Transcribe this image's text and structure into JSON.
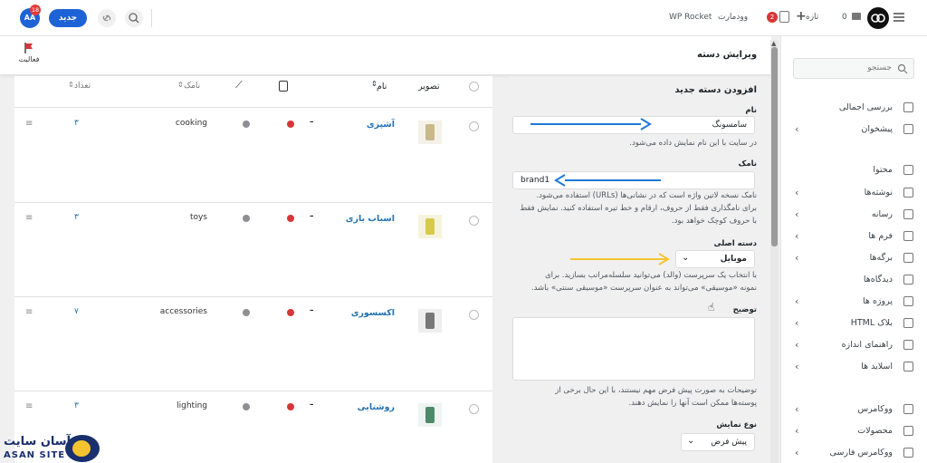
{
  "topbar": {
    "new_label": "جدید",
    "avatar_initials": "AA",
    "avatar_badge": "18",
    "wp_rocket": "WP Rocket",
    "wordmart": "وودمارت",
    "updates_count": "2",
    "new_item": "تازه",
    "comments_count": "0"
  },
  "sidebar": {
    "search_placeholder": "جستجو",
    "items": [
      {
        "label": "بررسی اجمالی",
        "icon": "dashboard-icon",
        "chevron": false
      },
      {
        "label": "پیشخوان",
        "icon": "grid-icon",
        "chevron": true
      },
      {
        "label": "محتوا",
        "icon": "database-icon",
        "chevron": false
      },
      {
        "label": "نوشته‌ها",
        "icon": "post-icon",
        "chevron": true
      },
      {
        "label": "رسانه",
        "icon": "media-icon",
        "chevron": true
      },
      {
        "label": "فرم ها",
        "icon": "form-icon",
        "chevron": true
      },
      {
        "label": "برگه‌ها",
        "icon": "page-icon",
        "chevron": true
      },
      {
        "label": "دیدگاه‌ها",
        "icon": "comment-icon",
        "chevron": false
      },
      {
        "label": "پروژه ها",
        "icon": "portfolio-icon",
        "chevron": true
      },
      {
        "label": "بلاک HTML",
        "icon": "html-block-icon",
        "chevron": true
      },
      {
        "label": "راهنمای اندازه",
        "icon": "size-guide-icon",
        "chevron": true
      },
      {
        "label": "اسلاید ها",
        "icon": "slides-icon",
        "chevron": true
      },
      {
        "label": "ووکامرس",
        "icon": "woo-icon",
        "chevron": true
      },
      {
        "label": "محصولات",
        "icon": "products-icon",
        "chevron": true
      },
      {
        "label": "ووکامرس فارسی",
        "icon": "woo-fa-icon",
        "chevron": true
      }
    ]
  },
  "header": {
    "title": "ویرایش دسته",
    "activity_label": "فعالیت"
  },
  "form": {
    "heading": "افزودن دسته جدید",
    "name_label": "نام",
    "name_value": "سامسونگ",
    "name_help": "در سایت با این نام نمایش داده می‌شود.",
    "slug_label": "نامک",
    "slug_value": "brand1",
    "slug_help_1": "نامک نسخه لاتین واژه است که در نشانی‌ها (URLs) استفاده می‌شود.",
    "slug_help_2": "برای نامگذاری فقط از حروف، ارقام و خط تیره استفاده کنید. نمایش فقط",
    "slug_help_3": "با حروف کوچک خواهد بود.",
    "parent_label": "دسته اصلی",
    "parent_value": "موبایل",
    "parent_help_1": "با انتخاب یک سرپرست (والد) می‌توانید سلسله‌مراتب بسازید. برای",
    "parent_help_2": "نمونه «موسیقی» می‌تواند به عنوان سرپرست «موسیقی سنتی» باشد.",
    "desc_label": "توضیح",
    "desc_help_1": "توضیحات به صورت پیش فرض مهم نیستند، با این حال برخی از",
    "desc_help_2": "پوسته‌ها ممکن است آنها را نمایش دهند.",
    "display_label": "نوع نمایش",
    "display_value": "پیش فرض"
  },
  "table": {
    "columns": {
      "image": "تصویر",
      "name": "نام",
      "slug": "نامک",
      "count": "تعداد"
    },
    "rows": [
      {
        "name": "آشپزی",
        "slug": "cooking",
        "count": "۳"
      },
      {
        "name": "اسباب بازی",
        "slug": "toys",
        "count": "۳"
      },
      {
        "name": "اکسسوری",
        "slug": "accessories",
        "count": "۷"
      },
      {
        "name": "روشنایی",
        "slug": "lighting",
        "count": "۳"
      }
    ]
  },
  "watermark": {
    "brand_fa": "آسان سایت",
    "brand_en": "ASAN SITE"
  },
  "colors": {
    "primary": "#2271b1",
    "arrow_blue": "#1e7ad6",
    "arrow_yellow": "#f4c430",
    "status_red": "#d63638",
    "badge_red": "#d63638"
  }
}
